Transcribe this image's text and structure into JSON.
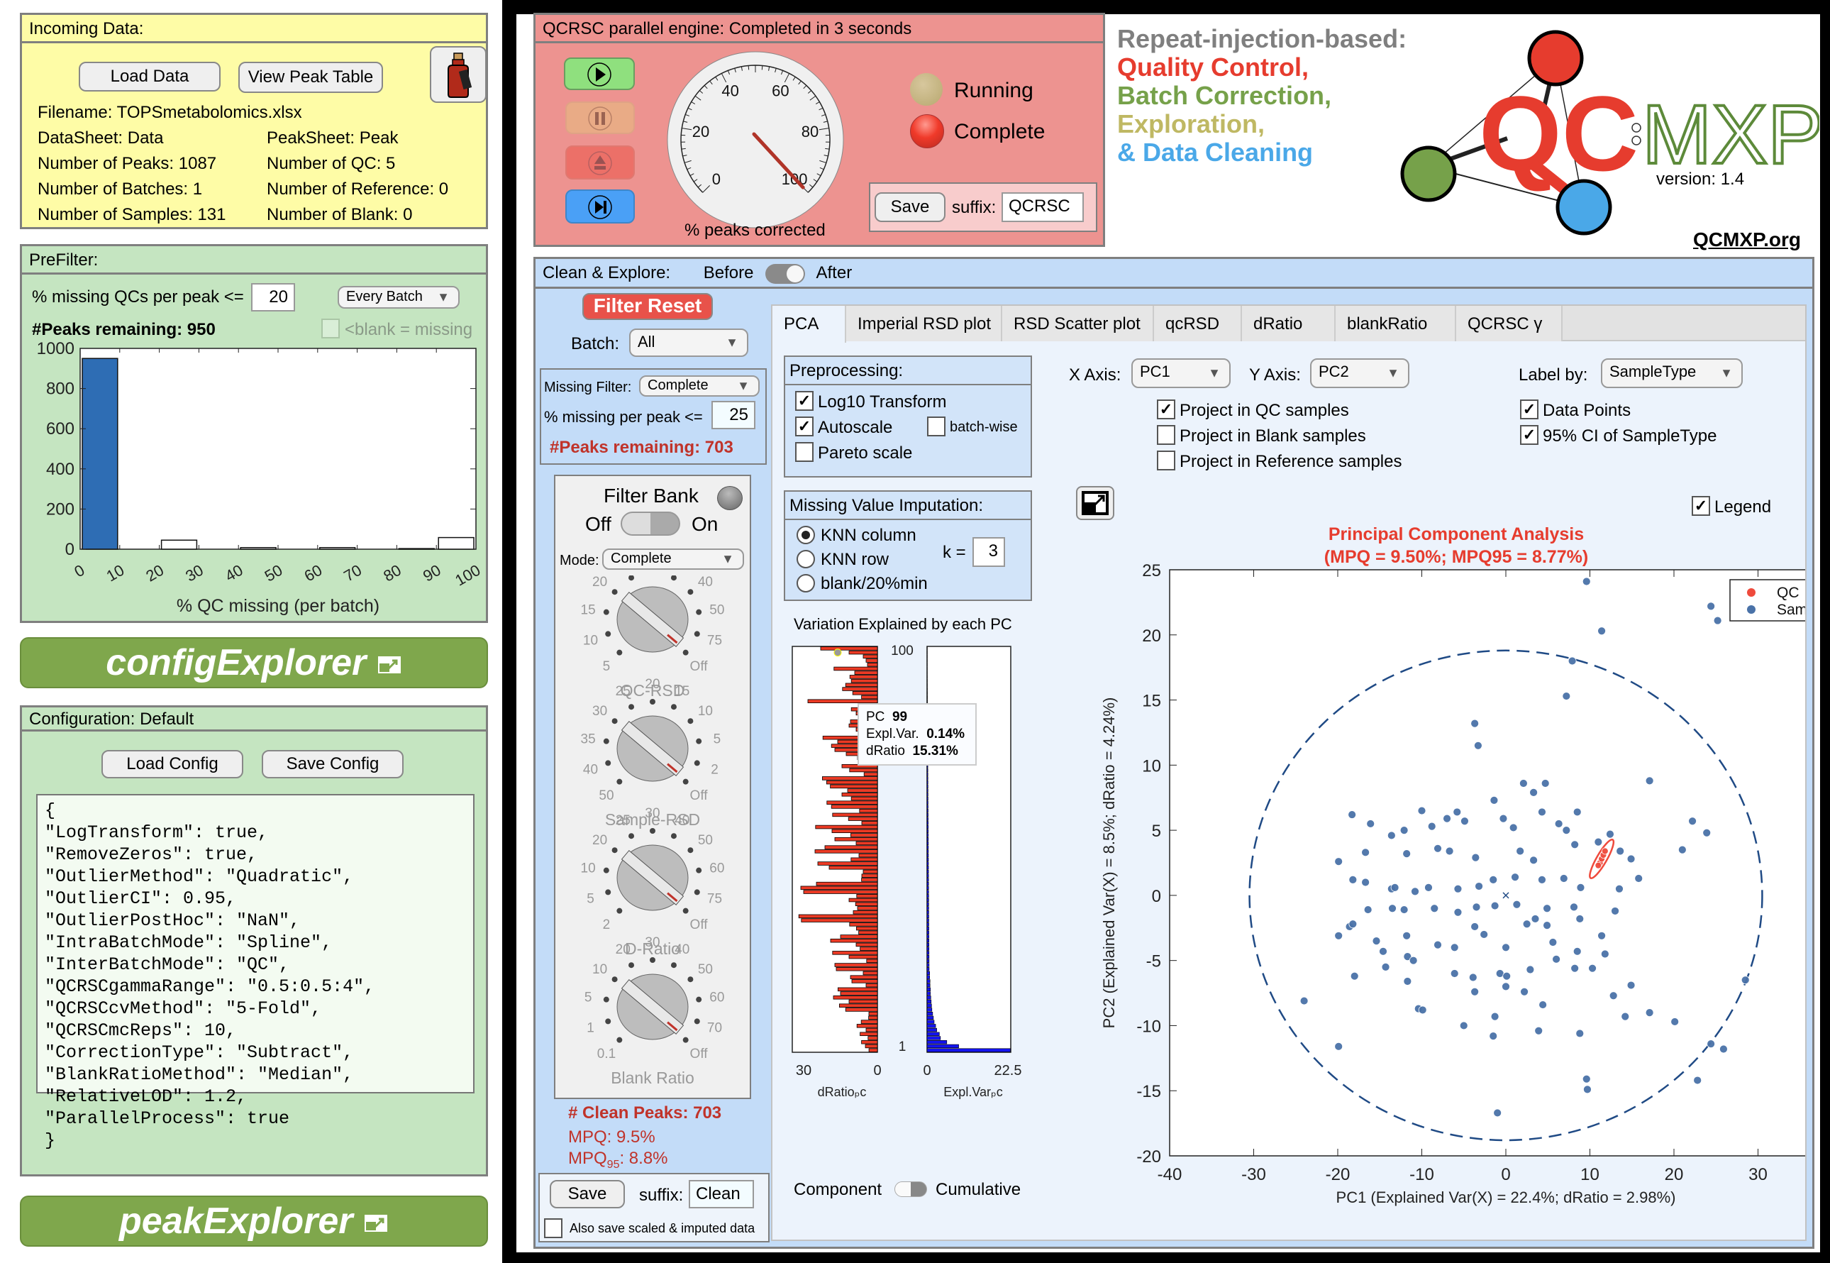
{
  "incoming": {
    "title": "Incoming Data:",
    "load_data": "Load Data",
    "view_peak_table": "View Peak Table",
    "bottle_icon": "potion-bottle-icon",
    "filename": "Filename: TOPSmetabolomics.xlsx",
    "datasheet": "DataSheet: Data",
    "peaksheet": "PeakSheet: Peak",
    "n_peaks": "Number of Peaks: 1087",
    "n_qc": "Number of QC: 5",
    "n_batches": "Number of Batches: 1",
    "n_reference": "Number of Reference: 0",
    "n_samples": "Number of Samples: 131",
    "n_blank": "Number of Blank: 0"
  },
  "prefilter": {
    "title": "PreFilter:",
    "missing_label": "% missing QCs per peak <=",
    "missing_value": "20",
    "batch_mode": "Every Batch",
    "peaks_remaining": "#Peaks remaining: 950",
    "blank_missing_label": "<blank = missing",
    "blank_missing_checked": false
  },
  "config_banner": "configExplorer",
  "peak_banner": "peakExplorer",
  "config": {
    "title": "Configuration: Default",
    "load": "Load Config",
    "save": "Save Config",
    "lines": [
      "{",
      "\"LogTransform\": true,",
      "\"RemoveZeros\": true,",
      "\"OutlierMethod\": \"Quadratic\",",
      "\"OutlierCI\": 0.95,",
      "\"OutlierPostHoc\": \"NaN\",",
      "\"IntraBatchMode\": \"Spline\",",
      "\"InterBatchMode\": \"QC\",",
      "\"QCRSCgammaRange\": \"0.5:0.5:4\",",
      "\"QCRSCcvMethod\": \"5-Fold\",",
      "\"QCRSCmcReps\": 10,",
      "\"CorrectionType\": \"Subtract\",",
      "\"BlankRatioMethod\": \"Median\",",
      "\"RelativeLOD\": 1.2,",
      "\"ParallelProcess\": true",
      "}"
    ]
  },
  "engine": {
    "title": "QCRSC parallel engine: Completed in 3 seconds",
    "gauge_label": "% peaks corrected",
    "gauge_value": 100,
    "gauge_ticks": [
      "0",
      "20",
      "40",
      "60",
      "80",
      "100"
    ],
    "running_label": "Running",
    "complete_label": "Complete",
    "save": "Save",
    "suffix_label": "suffix:",
    "suffix_value": "QCRSC"
  },
  "logo": {
    "line1": "Repeat-injection-based:",
    "line2": "Quality Control,",
    "line3": "Batch Correction,",
    "line4": "Exploration,",
    "line5": "& Data Cleaning",
    "qc": "QC",
    "mxp": "MXP",
    "version": "version: 1.4",
    "site": "QCMXP.org",
    "colors": {
      "red": "#e63c2e",
      "green": "#76a14a",
      "olive": "#bfb863",
      "blue": "#4aa8e8",
      "gray": "#7f7f7f"
    }
  },
  "clean": {
    "title": "Clean & Explore:",
    "before": "Before",
    "after": "After",
    "toggle_state": "After",
    "filter_reset": "Filter Reset",
    "batch_label": "Batch:",
    "batch_value": "All",
    "missing_filter_label": "Missing Filter:",
    "missing_filter_value": "Complete",
    "missing_per_peak_label": "% missing per peak <=",
    "missing_per_peak_value": "25",
    "peaks_remaining": "#Peaks remaining: 703",
    "filter_bank": "Filter Bank",
    "off": "Off",
    "on": "On",
    "mode_label": "Mode:",
    "mode_value": "Complete",
    "knobs": [
      {
        "name": "QC-RSD",
        "ticks": [
          "5",
          "10",
          "15",
          "20",
          "25",
          "30",
          "35",
          "40",
          "50",
          "75",
          "Off"
        ]
      },
      {
        "name": "Sample-RSD",
        "ticks": [
          "50",
          "40",
          "35",
          "30",
          "25",
          "20",
          "15",
          "10",
          "5",
          "2",
          "Off"
        ]
      },
      {
        "name": "D-Ratio",
        "ticks": [
          "2",
          "5",
          "10",
          "20",
          "25",
          "30",
          "40",
          "50",
          "60",
          "75",
          "Off"
        ]
      },
      {
        "name": "Blank Ratio",
        "ticks": [
          "0.1",
          "1",
          "5",
          "10",
          "20",
          "30",
          "40",
          "50",
          "60",
          "70",
          "Off"
        ]
      }
    ],
    "clean_peaks": "# Clean Peaks: 703",
    "mpq": "MPQ: 9.5%",
    "mpq95_prefix": "MPQ",
    "mpq95_sub": "95",
    "mpq95_value": ": 8.8%",
    "save": "Save",
    "suffix_label": "suffix:",
    "suffix_value": "Clean",
    "also_save": "Also save scaled & imputed data",
    "also_save_checked": false
  },
  "tabs": [
    "PCA",
    "Imperial RSD plot",
    "RSD Scatter plot",
    "qcRSD",
    "dRatio",
    "blankRatio",
    "QCRSC γ"
  ],
  "active_tab": "PCA",
  "pca": {
    "preprocessing_title": "Preprocessing:",
    "log10": "Log10 Transform",
    "log10_checked": true,
    "autoscale": "Autoscale",
    "autoscale_checked": true,
    "batchwise": "batch-wise",
    "batchwise_checked": false,
    "pareto": "Pareto scale",
    "pareto_checked": false,
    "imputation_title": "Missing Value Imputation:",
    "knn_column": "KNN column",
    "knn_row": "KNN row",
    "blank20": "blank/20%min",
    "imputation_selected": "KNN column",
    "k_label": "k =",
    "k_value": "3",
    "x_axis_label": "X Axis:",
    "x_axis_value": "PC1",
    "y_axis_label": "Y Axis:",
    "y_axis_value": "PC2",
    "label_by_label": "Label by:",
    "label_by_value": "SampleType",
    "proj_qc": "Project in QC samples",
    "proj_qc_checked": true,
    "proj_blank": "Project in Blank samples",
    "proj_blank_checked": false,
    "proj_ref": "Project in Reference samples",
    "proj_ref_checked": false,
    "data_points": "Data Points",
    "data_points_checked": true,
    "ci": "95% CI of SampleType",
    "ci_checked": true,
    "legend_label": "Legend",
    "legend_checked": true,
    "variation_title": "Variation Explained by each PC",
    "component": "Component",
    "cumulative": "Cumulative",
    "tooltip": {
      "pc_label": "PC",
      "pc": "99",
      "ev_label": "Expl.Var.",
      "ev": "0.14%",
      "dr_label": "dRatio",
      "dr": "15.31%"
    }
  },
  "chart_data": [
    {
      "type": "bar",
      "title": "",
      "xlabel": "% QC missing (per batch)",
      "ylabel": "",
      "categories": [
        "0-10",
        "10-20",
        "20-30",
        "30-40",
        "40-50",
        "50-60",
        "60-70",
        "70-80",
        "80-90",
        "90-100"
      ],
      "values": [
        950,
        0,
        45,
        0,
        8,
        0,
        8,
        0,
        3,
        58
      ],
      "highlight_first": true,
      "xticks": [
        "0",
        "10",
        "20",
        "30",
        "40",
        "50",
        "60",
        "70",
        "80",
        "90",
        "100"
      ],
      "yticks": [
        "0",
        "200",
        "400",
        "600",
        "800",
        "1000"
      ],
      "xlim": [
        0,
        100
      ],
      "ylim": [
        0,
        1000
      ]
    },
    {
      "type": "bar",
      "title": "Variation Explained by each PC",
      "orientation": "horizontal-mirrored",
      "left_series": {
        "name": "dRatio_PC",
        "xlim": [
          30,
          0
        ],
        "ticks": [
          "30",
          "0"
        ]
      },
      "right_series": {
        "name": "Expl.Var_PC",
        "xlim": [
          0,
          22.5
        ],
        "ticks": [
          "0",
          "22.5"
        ]
      },
      "y_ticks": [
        "1",
        "100"
      ],
      "n_components": 100,
      "explained_variance_top": [
        22.4,
        8.5,
        5.3,
        3.6,
        3.3,
        2.6,
        2.3,
        1.9,
        1.7,
        1.5,
        1.3,
        1.2,
        1.1,
        1.0,
        0.9,
        0.9,
        0.8,
        0.8,
        0.7,
        0.7
      ],
      "dratio_values": [
        2.98,
        4.24,
        5.6,
        3.3,
        6.1,
        4.0,
        7.2,
        5.7,
        3.1,
        3.0,
        11.2,
        13.4,
        10.0,
        15.5,
        13.0,
        13.9,
        4.0,
        9.0,
        9.5,
        5.0,
        14.5,
        15.0,
        3.8,
        10.0,
        15.8,
        6.1,
        7.5,
        16.5,
        13.0,
        6.6,
        7.4,
        9.8,
        26.8,
        27.7,
        8.5,
        7.0,
        7.7,
        10.0,
        7.3,
        26.0,
        27.0,
        21.5,
        5.6,
        5.5,
        5.0,
        17.0,
        21.0,
        9.3,
        6.5,
        22.0,
        18.5,
        7.5,
        15.0,
        9.4,
        16.0,
        21.8,
        5.5,
        10.2,
        15.8,
        6.3,
        16.2,
        17.8,
        9.2,
        12.5,
        10.5,
        16.6,
        17.9,
        19.4,
        4.7,
        9.8,
        12.5,
        5.5,
        7.0,
        11.0,
        15.0,
        16.2,
        14.0,
        19.2,
        4.5,
        7.5,
        10.0,
        9.5,
        3.8,
        7.5,
        9.2,
        6.8,
        24.5,
        5.6,
        8.7,
        12.3,
        11.2,
        9.2,
        9.7,
        8.0,
        15.31,
        3.5,
        4.0,
        5.0,
        10.0,
        20.0
      ],
      "tooltip_pc": 99
    },
    {
      "type": "scatter",
      "title": "Principal Component Analysis",
      "subtitle": "(MPQ = 9.50%; MPQ95 = 8.77%)",
      "xlabel": "PC1 (Explained Var(X) = 22.4%; dRatio = 2.98%)",
      "ylabel": "PC2 (Explained Var(X) = 8.5%; dRatio = 4.24%)",
      "xlim": [
        -40,
        40
      ],
      "ylim": [
        -20,
        25
      ],
      "xticks": [
        "-40",
        "-30",
        "-20",
        "-10",
        "0",
        "10",
        "20",
        "30",
        "40"
      ],
      "yticks": [
        "-20",
        "-15",
        "-10",
        "-5",
        "0",
        "5",
        "10",
        "15",
        "20",
        "25"
      ],
      "legend": [
        "QC",
        "Sample"
      ],
      "legend_position": "top-right",
      "colors": {
        "QC": "#ef4a3c",
        "Sample": "#4a72a8",
        "ci": "#1f4a85"
      },
      "ci_ellipse_sample": {
        "cx": 0,
        "cy": 0,
        "rx": 30.5,
        "ry": 18.8
      },
      "ci_ellipse_qc": {
        "cx": 11.4,
        "cy": 2.8,
        "rx": 0.6,
        "ry": 1.7,
        "angle_deg": 30
      },
      "centroid": [
        0,
        0
      ],
      "series": [
        {
          "name": "QC",
          "points": [
            [
              11.2,
              2.5
            ],
            [
              11.4,
              2.8
            ],
            [
              11.6,
              3.1
            ],
            [
              11.0,
              2.3
            ],
            [
              11.8,
              3.4
            ]
          ]
        },
        {
          "name": "Sample",
          "points": [
            [
              9.6,
              24.1
            ],
            [
              11.4,
              20.3
            ],
            [
              24.4,
              22.2
            ],
            [
              25.2,
              21.1
            ],
            [
              7.9,
              18.0
            ],
            [
              7.2,
              15.3
            ],
            [
              -3.7,
              13.2
            ],
            [
              -3.3,
              11.5
            ],
            [
              17.1,
              8.8
            ],
            [
              2.1,
              8.6
            ],
            [
              4.7,
              8.6
            ],
            [
              -18.3,
              6.2
            ],
            [
              -16.1,
              5.5
            ],
            [
              -13.6,
              4.6
            ],
            [
              -12.1,
              5.0
            ],
            [
              -10.0,
              6.5
            ],
            [
              -8.8,
              5.3
            ],
            [
              -7.0,
              5.9
            ],
            [
              -4.9,
              5.7
            ],
            [
              -5.8,
              6.4
            ],
            [
              -1.4,
              7.3
            ],
            [
              -0.3,
              5.9
            ],
            [
              0.9,
              5.2
            ],
            [
              3.3,
              7.9
            ],
            [
              4.3,
              6.4
            ],
            [
              6.3,
              5.5
            ],
            [
              7.2,
              5.0
            ],
            [
              8.5,
              6.4
            ],
            [
              8.2,
              3.9
            ],
            [
              11.0,
              4.1
            ],
            [
              12.4,
              4.7
            ],
            [
              13.6,
              3.4
            ],
            [
              14.9,
              2.8
            ],
            [
              22.2,
              5.7
            ],
            [
              23.9,
              4.8
            ],
            [
              21.0,
              3.5
            ],
            [
              -19.9,
              2.6
            ],
            [
              -16.7,
              3.3
            ],
            [
              -11.8,
              3.2
            ],
            [
              -8.1,
              3.6
            ],
            [
              -6.7,
              3.4
            ],
            [
              -3.6,
              2.9
            ],
            [
              1.7,
              3.4
            ],
            [
              3.3,
              2.7
            ],
            [
              -18.2,
              1.2
            ],
            [
              -16.7,
              1.0
            ],
            [
              -13.6,
              0.5
            ],
            [
              -13.2,
              0.6
            ],
            [
              -10.8,
              0.3
            ],
            [
              -9.2,
              0.6
            ],
            [
              -5.7,
              0.5
            ],
            [
              -3.2,
              0.7
            ],
            [
              -1.5,
              1.2
            ],
            [
              1.1,
              1.4
            ],
            [
              4.3,
              1.2
            ],
            [
              6.9,
              1.3
            ],
            [
              15.8,
              1.3
            ],
            [
              8.9,
              0.6
            ],
            [
              13.5,
              0.5
            ],
            [
              -13.5,
              -1.0
            ],
            [
              -12.1,
              -1.1
            ],
            [
              -8.5,
              -1.0
            ],
            [
              -5.7,
              -1.3
            ],
            [
              -3.5,
              -0.9
            ],
            [
              -1.3,
              -0.8
            ],
            [
              1.3,
              -0.7
            ],
            [
              3.5,
              -1.8
            ],
            [
              4.9,
              -1.0
            ],
            [
              8.1,
              -0.9
            ],
            [
              8.8,
              -1.8
            ],
            [
              13.0,
              -1.2
            ],
            [
              -16.4,
              -1.1
            ],
            [
              -19.9,
              -3.1
            ],
            [
              -18.6,
              -2.4
            ],
            [
              -18.2,
              -2.2
            ],
            [
              -15.4,
              -3.5
            ],
            [
              -14.6,
              -4.3
            ],
            [
              -11.8,
              -3.1
            ],
            [
              -11.7,
              -4.7
            ],
            [
              -8.1,
              -3.8
            ],
            [
              -6.1,
              -4.0
            ],
            [
              -3.7,
              -2.4
            ],
            [
              -2.6,
              -3.0
            ],
            [
              0.0,
              -4.0
            ],
            [
              2.5,
              -2.2
            ],
            [
              4.9,
              -2.3
            ],
            [
              5.6,
              -3.6
            ],
            [
              6.0,
              -4.9
            ],
            [
              8.5,
              -4.3
            ],
            [
              11.4,
              -3.1
            ],
            [
              11.8,
              -4.5
            ],
            [
              -14.3,
              -5.5
            ],
            [
              -11.0,
              -5.0
            ],
            [
              -6.1,
              -6.0
            ],
            [
              -3.9,
              -6.3
            ],
            [
              -0.7,
              -6.0
            ],
            [
              0.1,
              -6.2
            ],
            [
              2.9,
              -5.7
            ],
            [
              8.2,
              -5.6
            ],
            [
              10.3,
              -5.6
            ],
            [
              -18.0,
              -6.2
            ],
            [
              -11.7,
              -6.6
            ],
            [
              -3.7,
              -7.4
            ],
            [
              0.0,
              -7.0
            ],
            [
              2.2,
              -7.4
            ],
            [
              4.4,
              -8.4
            ],
            [
              12.8,
              -7.7
            ],
            [
              14.9,
              -6.9
            ],
            [
              -24.0,
              -8.1
            ],
            [
              -10.4,
              -8.7
            ],
            [
              -9.9,
              -8.8
            ],
            [
              -1.3,
              -9.3
            ],
            [
              -5.0,
              -10.0
            ],
            [
              -1.5,
              -10.8
            ],
            [
              3.9,
              -10.4
            ],
            [
              8.8,
              -10.6
            ],
            [
              14.2,
              -9.3
            ],
            [
              17.1,
              -9.0
            ],
            [
              20.1,
              -9.7
            ],
            [
              28.5,
              -6.5
            ],
            [
              -19.9,
              -11.6
            ],
            [
              24.4,
              -11.4
            ],
            [
              25.9,
              -11.8
            ],
            [
              9.6,
              -14.1
            ],
            [
              9.7,
              -14.9
            ],
            [
              22.8,
              -14.2
            ],
            [
              -1.0,
              -16.7
            ]
          ]
        }
      ]
    }
  ]
}
